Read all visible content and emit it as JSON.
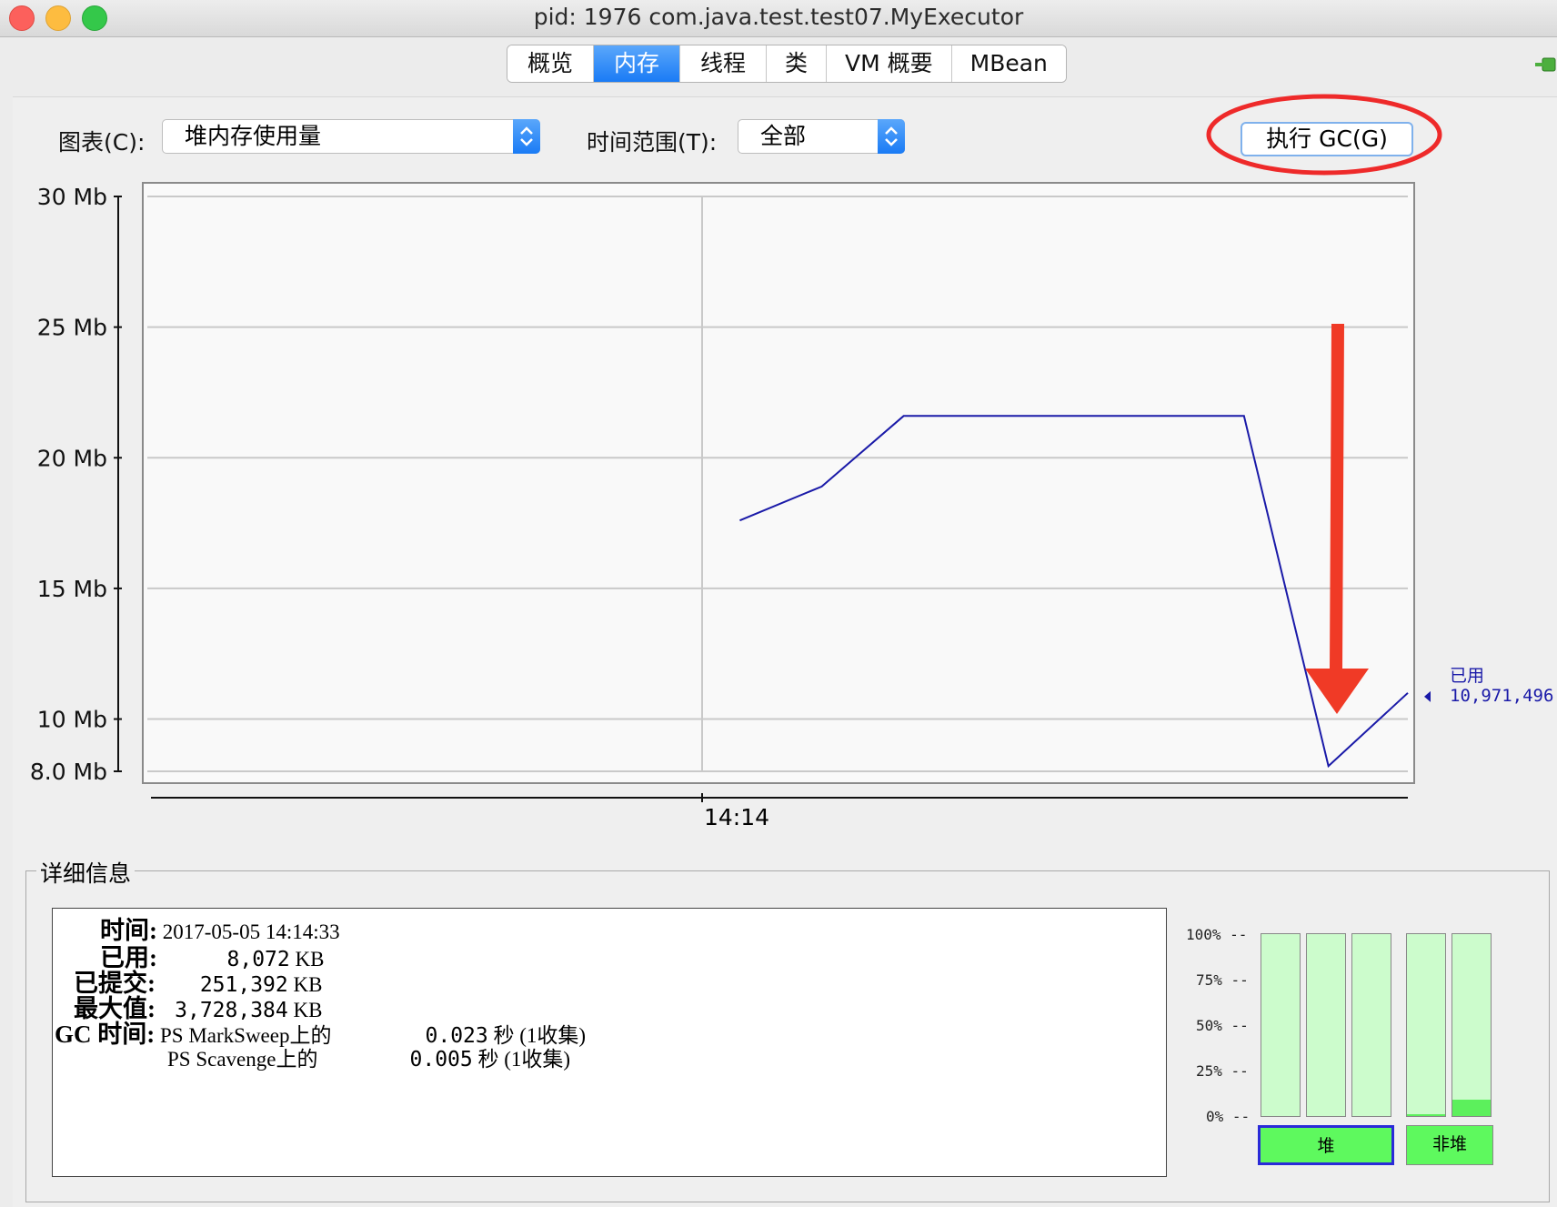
{
  "window": {
    "title": "pid: 1976 com.java.test.test07.MyExecutor"
  },
  "tabs": [
    {
      "label": "概览"
    },
    {
      "label": "内存",
      "active": true
    },
    {
      "label": "线程"
    },
    {
      "label": "类"
    },
    {
      "label": "VM 概要"
    },
    {
      "label": "MBean"
    }
  ],
  "toolbar": {
    "chart_label": "图表(C):",
    "chart_value": "堆内存使用量",
    "range_label": "时间范围(T):",
    "range_value": "全部",
    "gc_button": "执行 GC(G)"
  },
  "chart_data": {
    "type": "line",
    "title": "",
    "xlabel": "",
    "ylabel": "",
    "y_tick_labels": [
      "30 Mb",
      "25 Mb",
      "20 Mb",
      "15 Mb",
      "10 Mb",
      "8.0 Mb"
    ],
    "y_ticks": [
      30,
      25,
      20,
      15,
      10,
      8
    ],
    "ylim": [
      8,
      30
    ],
    "x_tick_label": "14:14",
    "grid": true,
    "series": [
      {
        "name": "已用",
        "color": "#1a1aa8",
        "x": [
          0.47,
          0.535,
          0.6,
          0.87,
          0.937,
          1.0
        ],
        "values": [
          17.6,
          18.9,
          21.6,
          21.6,
          8.2,
          11.0
        ]
      }
    ],
    "current": {
      "name": "已用",
      "value": "10,971,496"
    }
  },
  "details": {
    "legend": "详细信息",
    "time_key": "时间:",
    "time_value": "2017-05-05 14:14:33",
    "used_key": "已用:",
    "used_value": "8,072",
    "committed_key": "已提交:",
    "committed_value": "251,392",
    "max_key": "最大值:",
    "max_value": "3,728,384",
    "unit": "KB",
    "gc_key": "GC 时间:",
    "gc": [
      {
        "name": "PS MarkSweep上的",
        "value": "0.023",
        "unit": "秒",
        "count": "(1收集)"
      },
      {
        "name": "PS Scavenge上的",
        "value": "0.005",
        "unit": "秒",
        "count": "(1收集)"
      }
    ]
  },
  "pools": {
    "pct_labels": [
      "100% --",
      "75% --",
      "50% --",
      "25% --",
      "0% --"
    ],
    "heap_label": "堆",
    "nonheap_label": "非堆",
    "heap_levels": [
      0.0,
      0.0,
      0.0
    ],
    "nonheap_levels": [
      0.01,
      0.09
    ],
    "accent_fill": "#5cf05c",
    "accent_bg": "#ccfccc"
  }
}
